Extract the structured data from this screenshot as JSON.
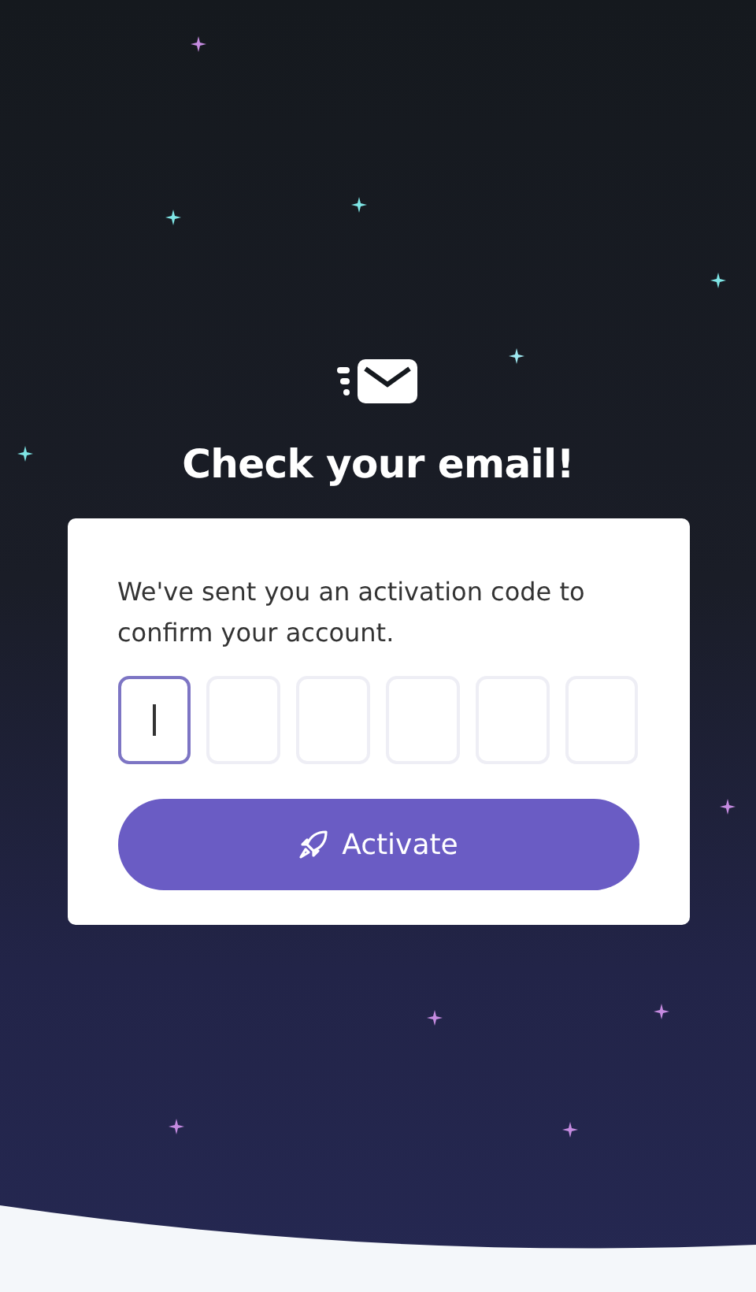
{
  "title": "Check your email!",
  "card": {
    "message": "We've sent you an activation code to confirm your account.",
    "code_boxes": [
      {
        "focused": true
      },
      {
        "focused": false
      },
      {
        "focused": false
      },
      {
        "focused": false
      },
      {
        "focused": false
      },
      {
        "focused": false
      }
    ],
    "button": {
      "label": "Activate"
    }
  }
}
